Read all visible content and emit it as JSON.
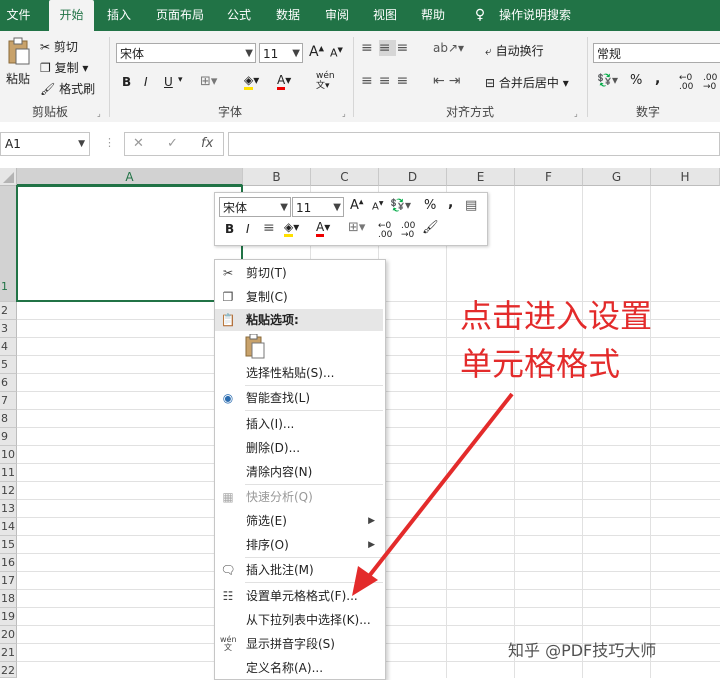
{
  "tabs": [
    "文件",
    "开始",
    "插入",
    "页面布局",
    "公式",
    "数据",
    "审阅",
    "视图",
    "帮助",
    "操作说明搜索"
  ],
  "clipboard": {
    "paste": "粘贴",
    "cut": "剪切",
    "copy": "复制",
    "format_painter": "格式刷",
    "label": "剪贴板"
  },
  "font": {
    "name": "宋体",
    "size": "11",
    "label": "字体",
    "bold": "B",
    "italic": "I",
    "underline": "U",
    "grow": "A",
    "shrink": "A"
  },
  "alignment": {
    "wrap": "自动换行",
    "merge": "合并后居中",
    "label": "对齐方式"
  },
  "number": {
    "format": "常规",
    "label": "数字",
    "percent": "%",
    "comma": ","
  },
  "formula_bar": {
    "name_box": "A1",
    "cancel": "✕",
    "enter": "✓",
    "fx": "fx"
  },
  "columns": [
    "A",
    "B",
    "C",
    "D",
    "E",
    "F",
    "G",
    "H"
  ],
  "rows": [
    "1",
    "2",
    "3",
    "4",
    "5",
    "6",
    "7",
    "8",
    "9",
    "10",
    "11",
    "12",
    "13",
    "14",
    "15",
    "16",
    "17",
    "18",
    "19",
    "20",
    "21",
    "22"
  ],
  "mini_toolbar": {
    "font": "宋体",
    "size": "11",
    "bold": "B",
    "italic": "I",
    "percent": "%",
    "comma": ","
  },
  "context_menu": {
    "cut": "剪切(T)",
    "copy": "复制(C)",
    "paste_options": "粘贴选项:",
    "paste_special": "选择性粘贴(S)...",
    "smart_lookup": "智能查找(L)",
    "insert": "插入(I)...",
    "delete": "删除(D)...",
    "clear": "清除内容(N)",
    "quick_analysis": "快速分析(Q)",
    "filter": "筛选(E)",
    "sort": "排序(O)",
    "insert_comment": "插入批注(M)",
    "format_cells": "设置单元格格式(F)...",
    "pick_list": "从下拉列表中选择(K)...",
    "phonetic": "显示拼音字段(S)",
    "define_name": "定义名称(A)..."
  },
  "annotation": {
    "line1": "点击进入设置",
    "line2": "单元格格式"
  },
  "watermark": "知乎 @PDF技巧大师",
  "colors": {
    "accent": "#217346",
    "annotation": "#e32b2b"
  }
}
